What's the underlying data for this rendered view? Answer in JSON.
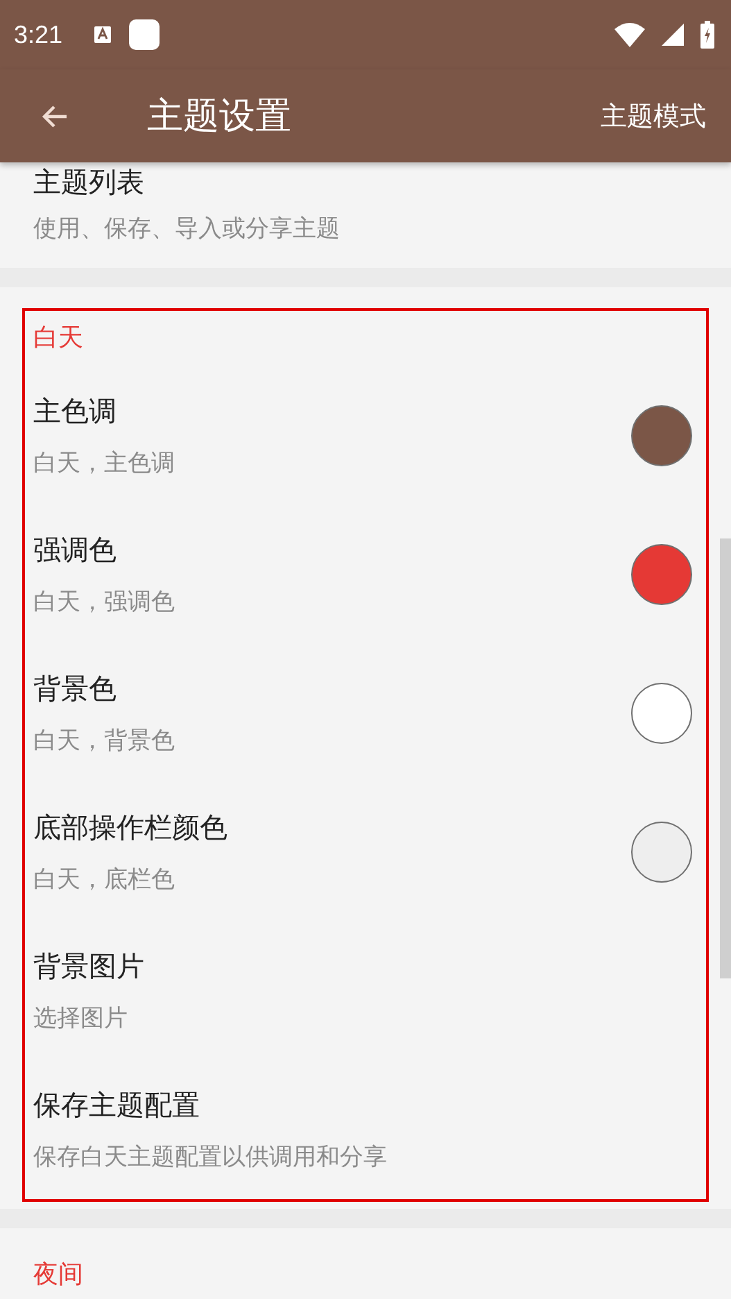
{
  "status_bar": {
    "time": "3:21"
  },
  "app_bar": {
    "title": "主题设置",
    "action": "主题模式"
  },
  "top_item": {
    "title": "主题列表",
    "subtitle": "使用、保存、导入或分享主题"
  },
  "day_section": {
    "header": "白天",
    "highlighted": true,
    "rows": [
      {
        "kind": "swatch",
        "title": "主色调",
        "subtitle": "白天，主色调",
        "color": "#7b5647"
      },
      {
        "kind": "swatch",
        "title": "强调色",
        "subtitle": "白天，强调色",
        "color": "#e53935"
      },
      {
        "kind": "swatch",
        "title": "背景色",
        "subtitle": "白天，背景色",
        "color": "#ffffff"
      },
      {
        "kind": "swatch",
        "title": "底部操作栏颜色",
        "subtitle": "白天，底栏色",
        "color": "#eeeeee"
      },
      {
        "kind": "plain",
        "title": "背景图片",
        "subtitle": "选择图片"
      },
      {
        "kind": "plain",
        "title": "保存主题配置",
        "subtitle": "保存白天主题配置以供调用和分享"
      }
    ]
  },
  "night_section": {
    "header": "夜间"
  }
}
